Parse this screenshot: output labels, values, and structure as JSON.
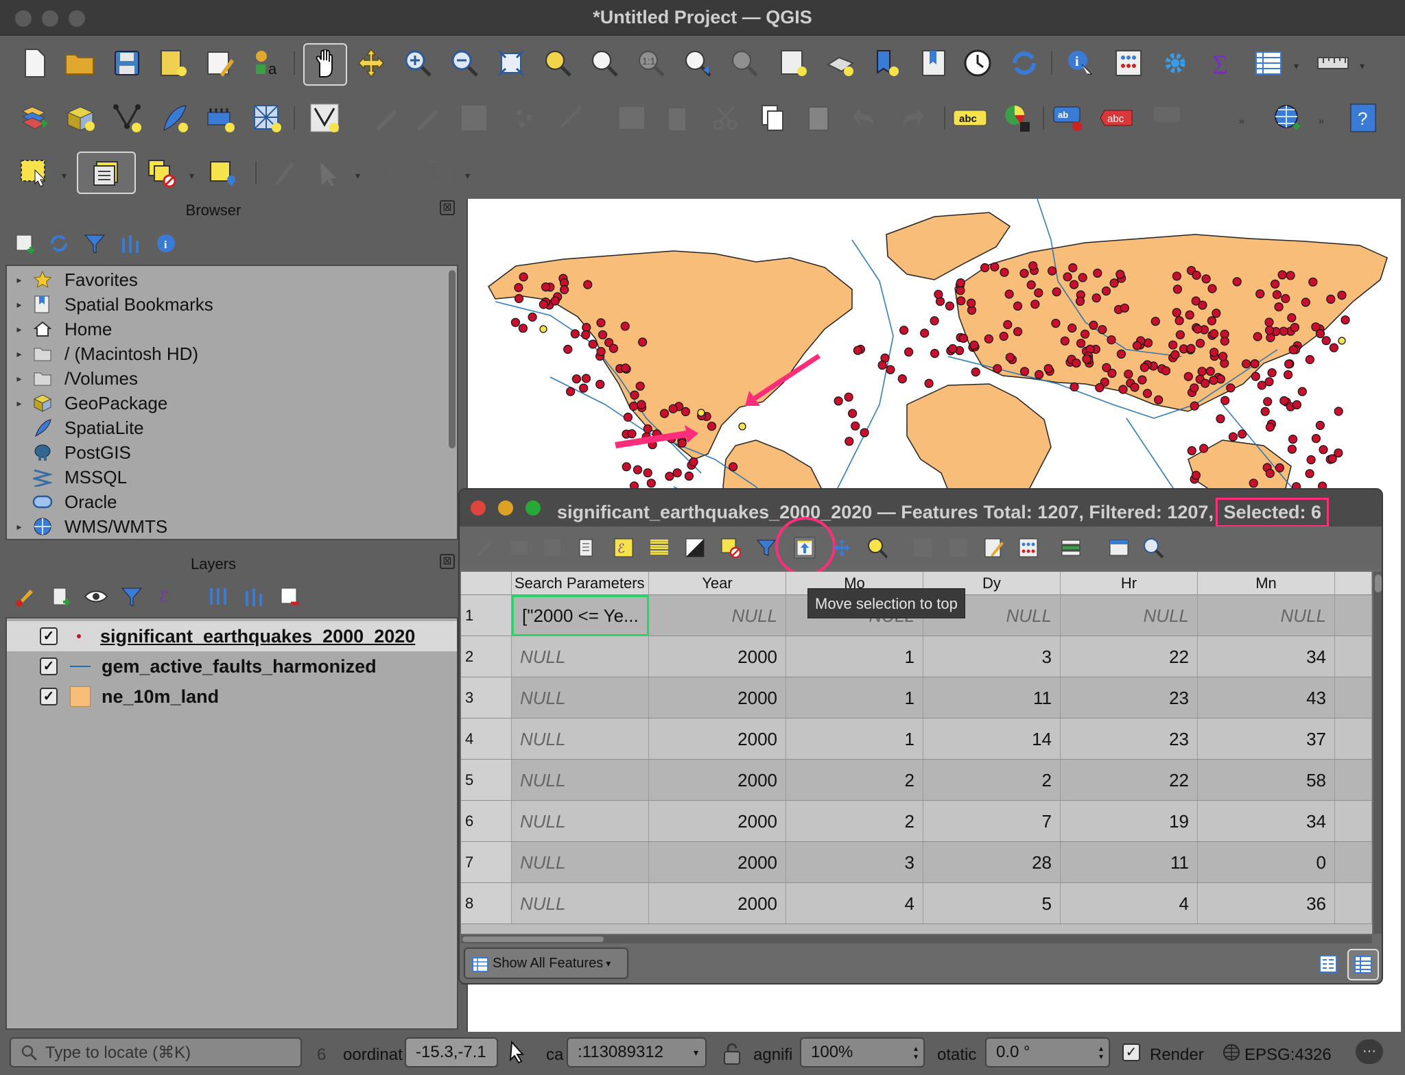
{
  "window": {
    "title": "*Untitled Project — QGIS"
  },
  "browser_panel": {
    "title": "Browser",
    "close": "⊠",
    "items": [
      {
        "label": "Favorites",
        "icon": "star-icon"
      },
      {
        "label": "Spatial Bookmarks",
        "icon": "bookmark-icon"
      },
      {
        "label": "Home",
        "icon": "home-icon"
      },
      {
        "label": "/ (Macintosh HD)",
        "icon": "folder-icon"
      },
      {
        "label": "/Volumes",
        "icon": "folder-icon"
      },
      {
        "label": "GeoPackage",
        "icon": "geopackage-icon"
      },
      {
        "label": "SpatiaLite",
        "icon": "feather-icon"
      },
      {
        "label": "PostGIS",
        "icon": "elephant-icon"
      },
      {
        "label": "MSSQL",
        "icon": "mssql-icon"
      },
      {
        "label": "Oracle",
        "icon": "oracle-icon"
      },
      {
        "label": "WMS/WMTS",
        "icon": "globe-icon"
      }
    ]
  },
  "layers_panel": {
    "title": "Layers",
    "close": "⊠",
    "layers": [
      {
        "name": "significant_earthquakes_2000_2020",
        "checked": "✓",
        "selected": true
      },
      {
        "name": "gem_active_faults_harmonized",
        "checked": "✓"
      },
      {
        "name": "ne_10m_land",
        "checked": "✓"
      }
    ]
  },
  "attribute_table": {
    "title": "significant_earthquakes_2000_2020 — Features Total: 1207, Filtered: 1207, ",
    "selected_text": "Selected: 6",
    "tooltip": "Move selection to top",
    "columns": [
      "Search Parameters",
      "Year",
      "Mo",
      "Dy",
      "Hr",
      "Mn"
    ],
    "rows": [
      {
        "n": "1",
        "cells": [
          "[\"2000 <= Ye...",
          "NULL",
          "NULL",
          "NULL",
          "NULL",
          "NULL"
        ]
      },
      {
        "n": "2",
        "cells": [
          "NULL",
          "2000",
          "1",
          "3",
          "22",
          "34"
        ]
      },
      {
        "n": "3",
        "cells": [
          "NULL",
          "2000",
          "1",
          "11",
          "23",
          "43"
        ]
      },
      {
        "n": "4",
        "cells": [
          "NULL",
          "2000",
          "1",
          "14",
          "23",
          "37"
        ]
      },
      {
        "n": "5",
        "cells": [
          "NULL",
          "2000",
          "2",
          "2",
          "22",
          "58"
        ]
      },
      {
        "n": "6",
        "cells": [
          "NULL",
          "2000",
          "2",
          "7",
          "19",
          "34"
        ]
      },
      {
        "n": "7",
        "cells": [
          "NULL",
          "2000",
          "3",
          "28",
          "11",
          "0"
        ]
      },
      {
        "n": "8",
        "cells": [
          "NULL",
          "2000",
          "4",
          "5",
          "4",
          "36"
        ]
      }
    ],
    "show_all": "Show All Features"
  },
  "statusbar": {
    "locate_placeholder": "Type to locate (⌘K)",
    "count": "6",
    "coord_label": "oordinat",
    "coord_value": "-15.3,-7.1",
    "scale_label": "ca",
    "scale_value": ":113089312",
    "magnifier_label": "agnifi",
    "magnifier_value": "100%",
    "rotation_label": "otatic",
    "rotation_value": "0.0 °",
    "render_label": "Render",
    "render_checked": "✓",
    "crs": "EPSG:4326",
    "more": "···"
  },
  "colors": {
    "land": "#f8bd78",
    "quake": "#c8102e",
    "fault": "#1f6fb2",
    "highlight": "#ff2d7a",
    "selected_cell": "#2bd46a"
  }
}
